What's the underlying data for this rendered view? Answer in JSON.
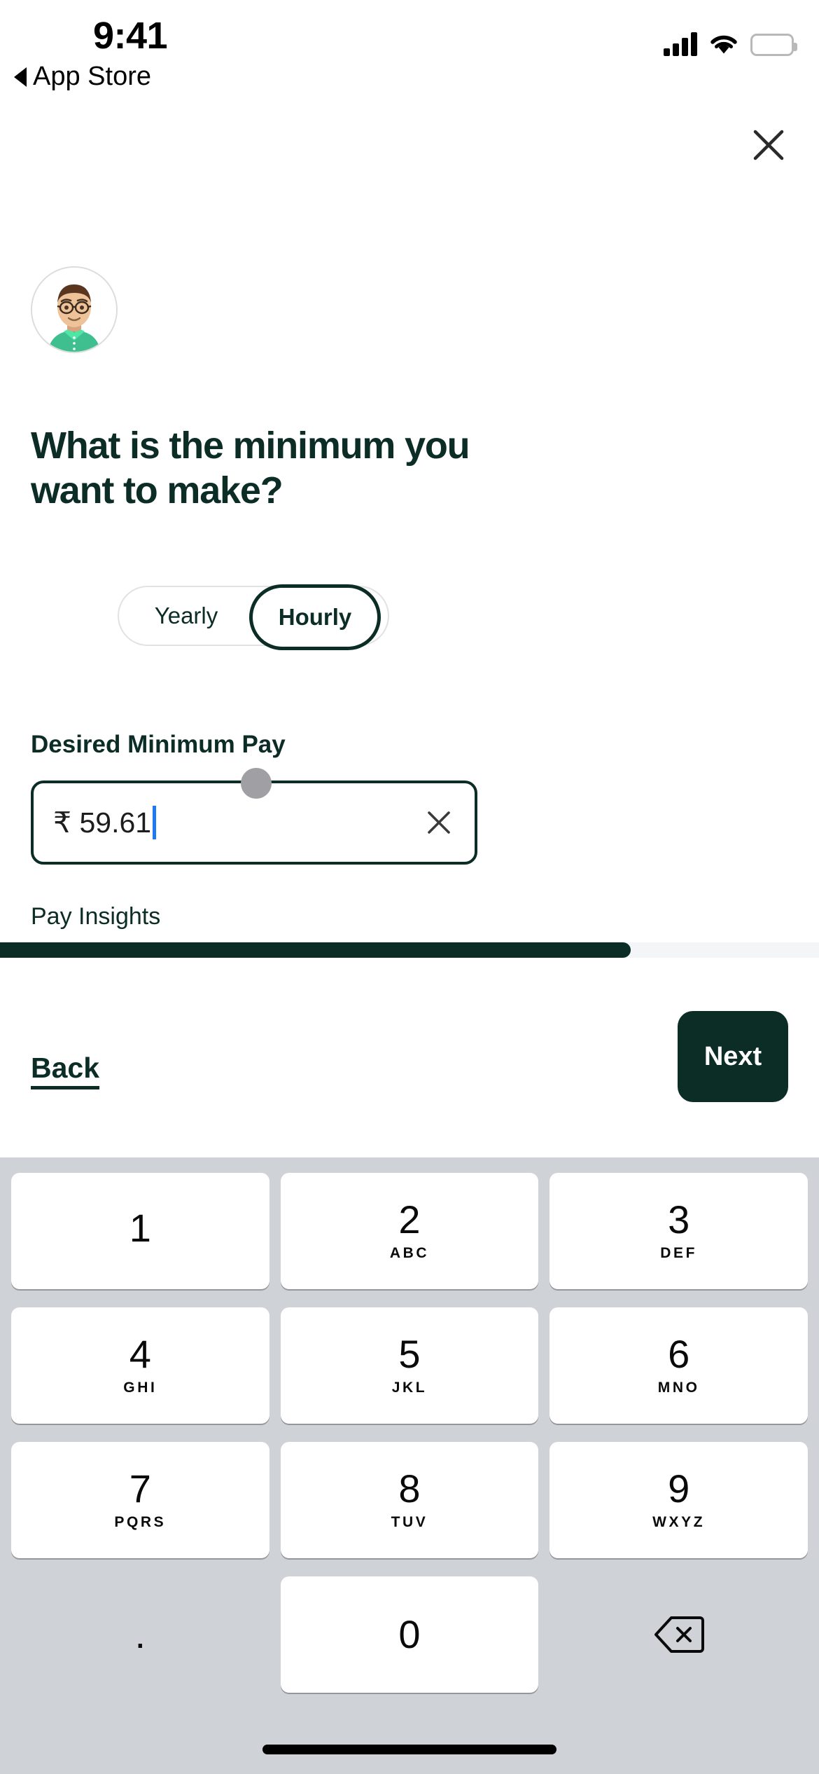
{
  "status_bar": {
    "time": "9:41",
    "back_app": "App Store",
    "icons": [
      "cellular-signal-icon",
      "wifi-icon",
      "battery-icon"
    ]
  },
  "header": {
    "close_label": "×"
  },
  "avatar": {
    "alt": "user-avatar"
  },
  "main": {
    "heading": "What is the minimum you want to make?",
    "pay_period_toggle": {
      "options": [
        "Yearly",
        "Hourly"
      ],
      "selected": "Hourly"
    },
    "field_label": "Desired Minimum Pay",
    "input": {
      "value": "₹ 59.61",
      "currency_symbol": "₹",
      "amount": "59.61",
      "clear_icon": "close-icon"
    },
    "pay_insights_label": "Pay Insights"
  },
  "progress": {
    "percent": 77
  },
  "nav": {
    "back_label": "Back",
    "next_label": "Next"
  },
  "keypad": {
    "rows": [
      [
        {
          "num": "1",
          "sub": ""
        },
        {
          "num": "2",
          "sub": "ABC"
        },
        {
          "num": "3",
          "sub": "DEF"
        }
      ],
      [
        {
          "num": "4",
          "sub": "GHI"
        },
        {
          "num": "5",
          "sub": "JKL"
        },
        {
          "num": "6",
          "sub": "MNO"
        }
      ],
      [
        {
          "num": "7",
          "sub": "PQRS"
        },
        {
          "num": "8",
          "sub": "TUV"
        },
        {
          "num": "9",
          "sub": "WXYZ"
        }
      ]
    ],
    "bottom": {
      "decimal": ".",
      "zero": "0",
      "delete_icon": "backspace-icon"
    }
  },
  "colors": {
    "brand_dark_green": "#0c2c26",
    "keyboard_bg": "#cfd2d7",
    "key_white": "#ffffff",
    "caret_blue": "#1c7bf2",
    "progress_track": "#f4f5f6",
    "touch_dot": "#a0a0a4"
  }
}
